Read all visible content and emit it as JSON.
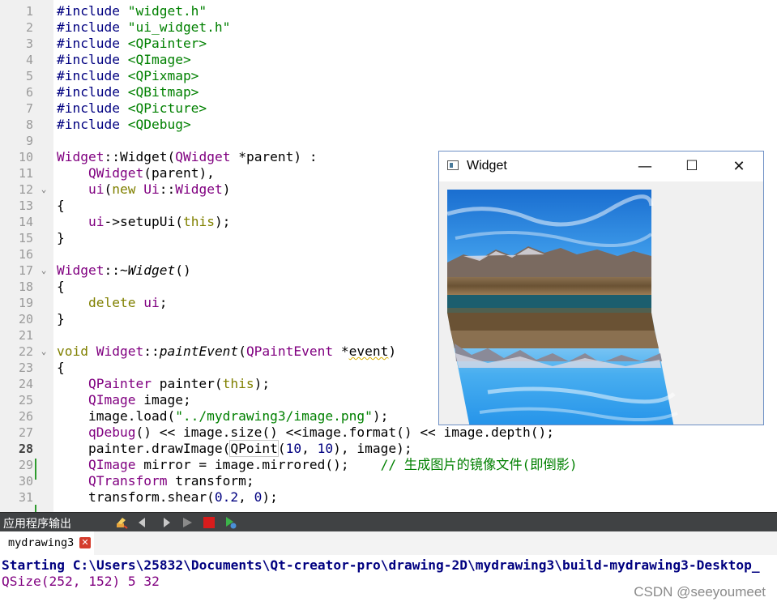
{
  "editor": {
    "lines": [
      {
        "n": "1",
        "t": [
          [
            "pp",
            "#include "
          ],
          [
            "inc",
            "\"widget.h\""
          ]
        ]
      },
      {
        "n": "2",
        "t": [
          [
            "pp",
            "#include "
          ],
          [
            "inc",
            "\"ui_widget.h\""
          ]
        ]
      },
      {
        "n": "3",
        "t": [
          [
            "pp",
            "#include "
          ],
          [
            "inc",
            "<QPainter>"
          ]
        ]
      },
      {
        "n": "4",
        "t": [
          [
            "pp",
            "#include "
          ],
          [
            "inc",
            "<QImage>"
          ]
        ]
      },
      {
        "n": "5",
        "t": [
          [
            "pp",
            "#include "
          ],
          [
            "inc",
            "<QPixmap>"
          ]
        ]
      },
      {
        "n": "6",
        "t": [
          [
            "pp",
            "#include "
          ],
          [
            "inc",
            "<QBitmap>"
          ]
        ]
      },
      {
        "n": "7",
        "t": [
          [
            "pp",
            "#include "
          ],
          [
            "inc",
            "<QPicture>"
          ]
        ]
      },
      {
        "n": "8",
        "t": [
          [
            "pp",
            "#include "
          ],
          [
            "inc",
            "<QDebug>"
          ]
        ]
      },
      {
        "n": "9",
        "t": []
      },
      {
        "n": "10",
        "t": [
          [
            "typ",
            "Widget"
          ],
          [
            "",
            "::"
          ],
          [
            "",
            "Widget"
          ],
          [
            "",
            "("
          ],
          [
            "typ",
            "QWidget"
          ],
          [
            "",
            " *parent) :"
          ]
        ]
      },
      {
        "n": "11",
        "t": [
          [
            "",
            "    "
          ],
          [
            "typ",
            "QWidget"
          ],
          [
            "",
            "(parent),"
          ]
        ]
      },
      {
        "n": "12",
        "fold": true,
        "t": [
          [
            "",
            "    "
          ],
          [
            "typ",
            "ui"
          ],
          [
            "",
            "("
          ],
          [
            "kw",
            "new"
          ],
          [
            "",
            " "
          ],
          [
            "typ",
            "Ui"
          ],
          [
            "",
            "::"
          ],
          [
            "typ",
            "Widget"
          ],
          [
            "",
            ")"
          ]
        ]
      },
      {
        "n": "13",
        "t": [
          [
            "",
            "{"
          ]
        ]
      },
      {
        "n": "14",
        "t": [
          [
            "",
            "    "
          ],
          [
            "typ",
            "ui"
          ],
          [
            "",
            "->setupUi("
          ],
          [
            "kw",
            "this"
          ],
          [
            "",
            ");"
          ]
        ]
      },
      {
        "n": "15",
        "t": [
          [
            "",
            "}"
          ]
        ]
      },
      {
        "n": "16",
        "t": []
      },
      {
        "n": "17",
        "fold": true,
        "t": [
          [
            "typ",
            "Widget"
          ],
          [
            "",
            "::~"
          ],
          [
            "ital",
            "Widget"
          ],
          [
            "",
            "()"
          ]
        ]
      },
      {
        "n": "18",
        "t": [
          [
            "",
            "{"
          ]
        ]
      },
      {
        "n": "19",
        "t": [
          [
            "",
            "    "
          ],
          [
            "kw",
            "delete"
          ],
          [
            "",
            " "
          ],
          [
            "typ",
            "ui"
          ],
          [
            "",
            ";"
          ]
        ]
      },
      {
        "n": "20",
        "t": [
          [
            "",
            "}"
          ]
        ]
      },
      {
        "n": "21",
        "t": []
      },
      {
        "n": "22",
        "fold": true,
        "t": [
          [
            "kw",
            "void"
          ],
          [
            "",
            " "
          ],
          [
            "typ",
            "Widget"
          ],
          [
            "",
            "::"
          ],
          [
            "ital",
            "paintEvent"
          ],
          [
            "",
            "("
          ],
          [
            "typ",
            "QPaintEvent"
          ],
          [
            "",
            " *"
          ],
          [
            "warn",
            "event"
          ],
          [
            "",
            ")"
          ]
        ]
      },
      {
        "n": "23",
        "t": [
          [
            "",
            "{"
          ]
        ]
      },
      {
        "n": "24",
        "t": [
          [
            "",
            "    "
          ],
          [
            "typ",
            "QPainter"
          ],
          [
            "",
            " painter("
          ],
          [
            "kw",
            "this"
          ],
          [
            "",
            ");"
          ]
        ]
      },
      {
        "n": "25",
        "t": [
          [
            "",
            "    "
          ],
          [
            "typ",
            "QImage"
          ],
          [
            "",
            " image;"
          ]
        ]
      },
      {
        "n": "26",
        "t": [
          [
            "",
            "    image.load("
          ],
          [
            "inc",
            "\"../mydrawing3/image.png\""
          ],
          [
            "",
            ");"
          ]
        ]
      },
      {
        "n": "27",
        "t": [
          [
            "",
            "    "
          ],
          [
            "typ",
            "qDebug"
          ],
          [
            "",
            "() << image.size() <<image.format() << image.depth();"
          ]
        ]
      },
      {
        "n": "28",
        "cur": true,
        "t": [
          [
            "",
            "    painter.drawImage("
          ],
          [
            "boxed",
            "QPoint"
          ],
          [
            "",
            "("
          ],
          [
            "num",
            "10"
          ],
          [
            "",
            ", "
          ],
          [
            "num",
            "10"
          ],
          [
            "",
            "), image);"
          ]
        ]
      },
      {
        "n": "29",
        "t": [
          [
            "",
            "    "
          ],
          [
            "typ",
            "QImage"
          ],
          [
            "",
            " mirror = image.mirrored();    "
          ],
          [
            "com",
            "// 生成图片的镜像文件(即倒影)"
          ]
        ]
      },
      {
        "n": "30",
        "t": [
          [
            "",
            "    "
          ],
          [
            "typ",
            "QTransform"
          ],
          [
            "",
            " transform;"
          ]
        ]
      },
      {
        "n": "31",
        "t": [
          [
            "",
            "    transform.shear("
          ],
          [
            "num",
            "0.2"
          ],
          [
            "",
            ", "
          ],
          [
            "num",
            "0"
          ],
          [
            "",
            ");"
          ]
        ]
      }
    ]
  },
  "widget_window": {
    "title": "Widget",
    "min_glyph": "—",
    "max_glyph": "☐",
    "close_glyph": "✕"
  },
  "output": {
    "panel_title": "应用程序输出",
    "tab_label": "mydrawing3",
    "tab_close": "✕",
    "line1": "Starting C:\\Users\\25832\\Documents\\Qt-creator-pro\\drawing-2D\\mydrawing3\\build-mydrawing3-Desktop_",
    "line2": "QSize(252, 152) 5 32"
  },
  "watermark": "CSDN @seeyoumeet",
  "colors": {
    "keyword": "#808000",
    "type": "#800080",
    "string": "#008000",
    "number": "#000080",
    "output_text": "#000080"
  }
}
